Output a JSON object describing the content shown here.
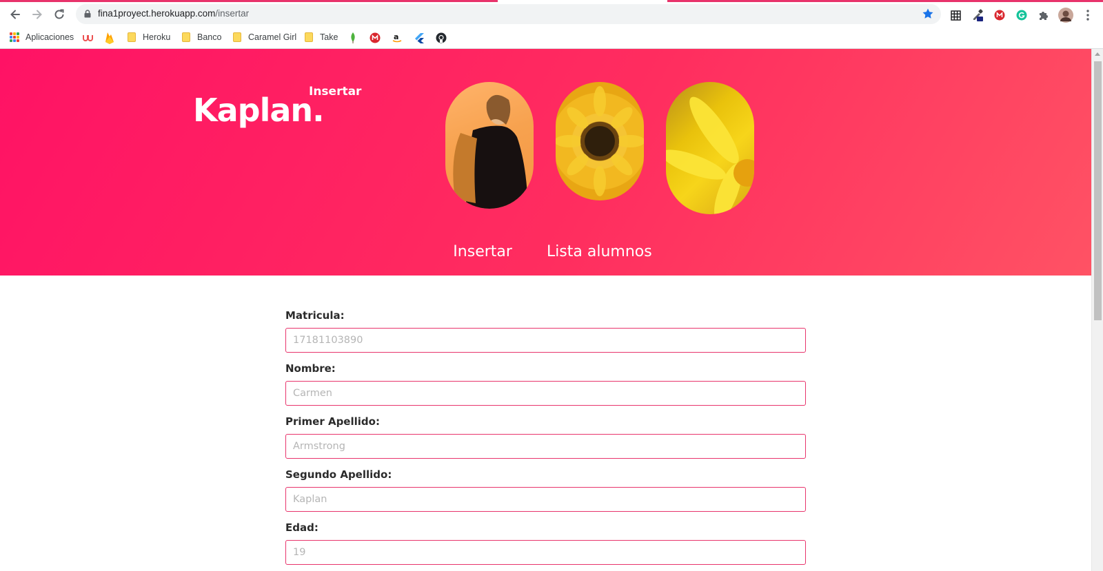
{
  "browser": {
    "url_host": "fina1proyect.herokuapp.com",
    "url_path": "/insertar",
    "bookmarks": [
      {
        "label": "Aplicaciones",
        "icon": "apps-grid-icon"
      },
      {
        "label": "",
        "icon": "udemy-icon"
      },
      {
        "label": "",
        "icon": "firebase-icon"
      },
      {
        "label": "Heroku",
        "icon": "folder-icon"
      },
      {
        "label": "Banco",
        "icon": "folder-icon"
      },
      {
        "label": "Caramel Girl",
        "icon": "folder-icon"
      },
      {
        "label": "Take",
        "icon": "folder-icon"
      },
      {
        "label": "",
        "icon": "mongodb-leaf-icon"
      },
      {
        "label": "",
        "icon": "mega-icon"
      },
      {
        "label": "",
        "icon": "amazon-icon"
      },
      {
        "label": "",
        "icon": "flutter-icon"
      },
      {
        "label": "",
        "icon": "github-icon"
      }
    ],
    "extensions": [
      "grid-extension-icon",
      "eyedropper-extension-icon",
      "mega-extension-icon",
      "grammarly-icon",
      "puzzle-extensions-icon",
      "profile-avatar",
      "kebab-menu-icon"
    ]
  },
  "header": {
    "brand": "Kaplan.",
    "page_label": "Insertar",
    "images": [
      "woman-backpack-photo",
      "sunflower-photo",
      "yellow-flower-photo"
    ],
    "nav": [
      {
        "label": "Insertar"
      },
      {
        "label": "Lista alumnos"
      }
    ]
  },
  "form": {
    "fields": [
      {
        "label": "Matricula:",
        "placeholder": "17181103890"
      },
      {
        "label": "Nombre:",
        "placeholder": "Carmen"
      },
      {
        "label": "Primer Apellido:",
        "placeholder": "Armstrong"
      },
      {
        "label": "Segundo Apellido:",
        "placeholder": "Kaplan"
      },
      {
        "label": "Edad:",
        "placeholder": "19"
      }
    ]
  },
  "colors": {
    "brand_pink": "#ff1265",
    "accent_border": "#e8336b"
  }
}
